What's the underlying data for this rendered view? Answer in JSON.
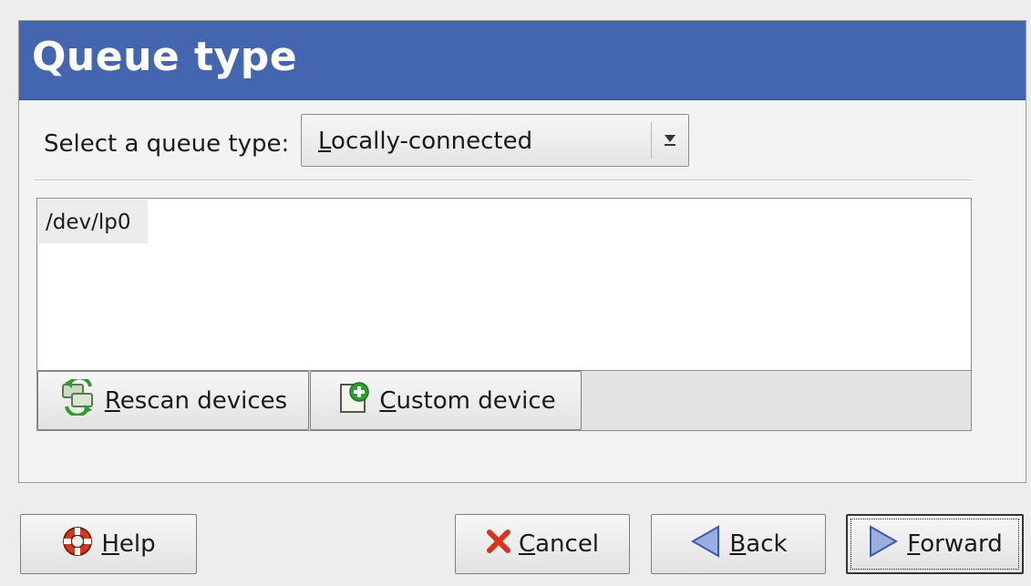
{
  "header": {
    "title": "Queue type"
  },
  "queue_type": {
    "label": "Select a queue type:",
    "selected_prefix": "L",
    "selected_rest": "ocally-connected"
  },
  "devices": {
    "items": [
      {
        "label": "/dev/lp0"
      }
    ]
  },
  "device_actions": {
    "rescan_mnemonic": "R",
    "rescan_rest": "escan devices",
    "custom_mnemonic": "C",
    "custom_rest": "ustom device"
  },
  "footer": {
    "help_mnemonic": "H",
    "help_rest": "elp",
    "cancel_mnemonic": "C",
    "cancel_rest": "ancel",
    "back_mnemonic": "B",
    "back_rest": "ack",
    "forward_mnemonic": "F",
    "forward_rest": "orward"
  },
  "colors": {
    "header_bg": "#4466b0",
    "header_text": "#ffffff"
  },
  "icons": {
    "combo_arrow": "chevron-down-icon",
    "rescan": "refresh-icon",
    "custom": "add-document-icon",
    "help": "lifebuoy-icon",
    "cancel": "red-x-icon",
    "back": "back-triangle-icon",
    "forward": "forward-triangle-icon"
  }
}
